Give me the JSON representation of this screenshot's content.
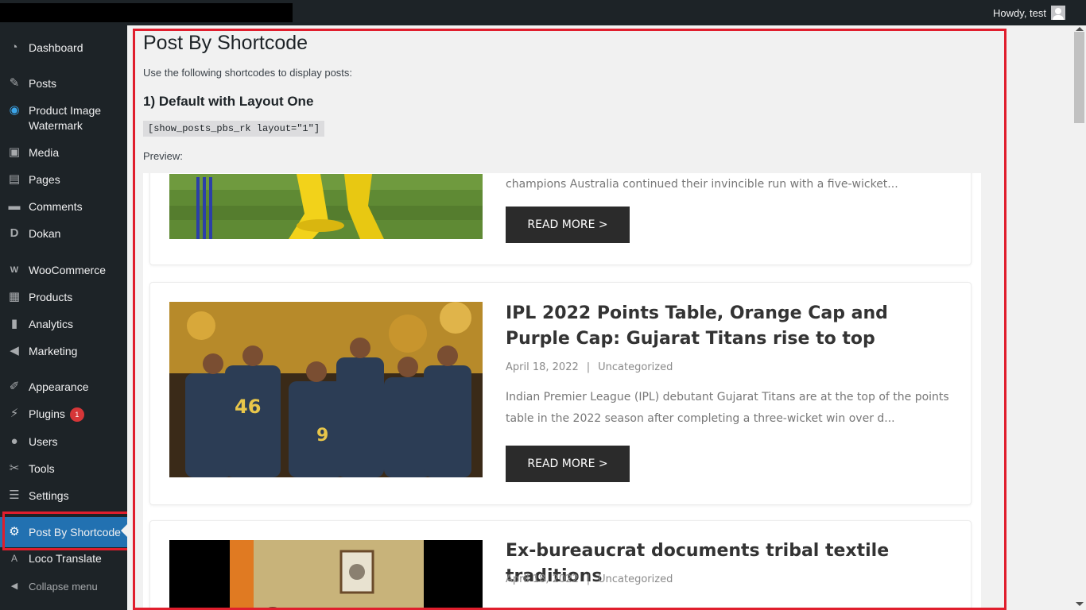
{
  "adminbar": {
    "howdy": "Howdy, test"
  },
  "sidebar": {
    "items": [
      {
        "label": "Dashboard",
        "icon": "dashboard-icon",
        "glyph": "◔"
      },
      {
        "label": "Posts",
        "icon": "pin-icon",
        "glyph": "✎"
      },
      {
        "label": "Product Image Watermark",
        "icon": "watermark-icon",
        "glyph": "◉"
      },
      {
        "label": "Media",
        "icon": "media-icon",
        "glyph": "▣"
      },
      {
        "label": "Pages",
        "icon": "pages-icon",
        "glyph": "▤"
      },
      {
        "label": "Comments",
        "icon": "comment-icon",
        "glyph": "▬"
      },
      {
        "label": "Dokan",
        "icon": "dokan-icon",
        "glyph": "D"
      },
      {
        "label": "WooCommerce",
        "icon": "woocommerce-icon",
        "glyph": "W"
      },
      {
        "label": "Products",
        "icon": "archive-icon",
        "glyph": "▦"
      },
      {
        "label": "Analytics",
        "icon": "bar-chart-icon",
        "glyph": "▮"
      },
      {
        "label": "Marketing",
        "icon": "megaphone-icon",
        "glyph": "◀"
      },
      {
        "label": "Appearance",
        "icon": "brush-icon",
        "glyph": "✐"
      },
      {
        "label": "Plugins",
        "icon": "plugin-icon",
        "glyph": "⚡",
        "badge": "1"
      },
      {
        "label": "Users",
        "icon": "user-icon",
        "glyph": "●"
      },
      {
        "label": "Tools",
        "icon": "wrench-icon",
        "glyph": "✂"
      },
      {
        "label": "Settings",
        "icon": "sliders-icon",
        "glyph": "☰"
      },
      {
        "label": "Post By Shortcode",
        "icon": "gear-icon",
        "glyph": "⚙"
      },
      {
        "label": "Loco Translate",
        "icon": "translate-icon",
        "glyph": "A"
      },
      {
        "label": "Collapse menu",
        "icon": "collapse-icon",
        "glyph": "◀"
      }
    ]
  },
  "main": {
    "title": "Post By Shortcode",
    "intro": "Use the following shortcodes to display posts:",
    "section_heading": "1) Default with Layout One",
    "shortcode": "[show_posts_pbs_rk layout=\"1\"]",
    "preview_label": "Preview:"
  },
  "posts": [
    {
      "title": "",
      "date": "",
      "category": "",
      "excerpt": "champions Australia continued their invincible run with a five-wicket...",
      "read_more": "READ MORE >"
    },
    {
      "title": "IPL 2022 Points Table, Orange Cap and Purple Cap: Gujarat Titans rise to top",
      "date": "April 18, 2022",
      "separator": "|",
      "category": "Uncategorized",
      "excerpt": "Indian Premier League (IPL) debutant Gujarat Titans are at the top of the points table in the 2022 season after completing a three-wicket win over d...",
      "read_more": "READ MORE >"
    },
    {
      "title": "Ex-bureaucrat documents tribal textile traditions",
      "date": "April 18, 2022",
      "separator": "|",
      "category": "Uncategorized",
      "excerpt": "",
      "read_more": ""
    }
  ]
}
